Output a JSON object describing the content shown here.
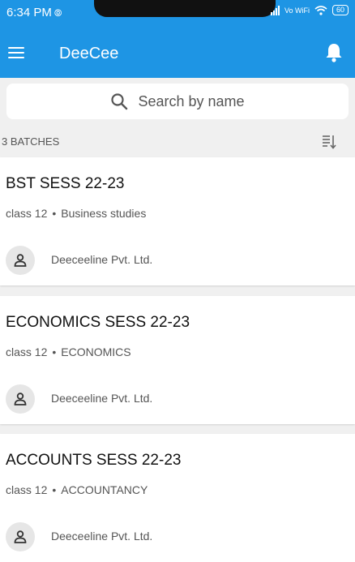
{
  "status": {
    "time": "6:34 PM",
    "network": "Vo WiFi",
    "battery": "60"
  },
  "appbar": {
    "title": "DeeCee"
  },
  "search": {
    "placeholder": "Search by name"
  },
  "batches": {
    "count_label": "3 BATCHES",
    "items": [
      {
        "title": "BST SESS 22-23",
        "class": "class 12",
        "subject": "Business studies",
        "org": "Deeceeline Pvt. Ltd."
      },
      {
        "title": "ECONOMICS SESS 22-23",
        "class": "class 12",
        "subject": "ECONOMICS",
        "org": "Deeceeline Pvt. Ltd."
      },
      {
        "title": "ACCOUNTS SESS 22-23",
        "class": "class 12",
        "subject": "ACCOUNTANCY",
        "org": "Deeceeline Pvt. Ltd."
      }
    ]
  },
  "icons": {
    "menu": "menu-icon",
    "bell": "bell-icon",
    "search": "search-icon",
    "sort": "sort-icon",
    "avatar": "person-icon"
  },
  "colors": {
    "primary": "#1e95e4",
    "background": "#f0f0f0"
  }
}
